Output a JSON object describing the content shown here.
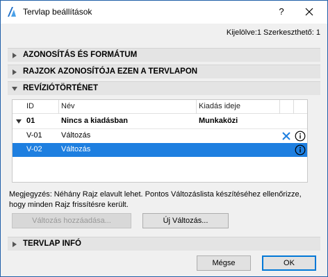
{
  "window": {
    "title": "Tervlap beállítások",
    "help_label": "?",
    "accent": "#1e7fe0"
  },
  "selection_info": "Kijelölve:1 Szerkeszthető: 1",
  "sections": {
    "id_format": "AZONOSÍTÁS ÉS FORMÁTUM",
    "drawings_id": "RAJZOK AZONOSÍTÓJA EZEN A TERVLAPON",
    "revision_history": "REVÍZIÓTÖRTÉNET",
    "sheet_info": "TERVLAP INFÓ"
  },
  "table": {
    "headers": {
      "id": "ID",
      "name": "Név",
      "issue_date": "Kiadás ideje"
    },
    "group": {
      "id": "01",
      "name": "Nincs a kiadásban",
      "issue_date": "Munkaközi"
    },
    "rows": [
      {
        "id": "V-01",
        "name": "Változás",
        "selected": false
      },
      {
        "id": "V-02",
        "name": "Változás",
        "selected": true
      }
    ]
  },
  "note": {
    "line1": "Megjegyzés: Néhány Rajz elavult lehet. Pontos Változáslista készítéséhez ellenőrizze,",
    "line2": "hogy minden Rajz frissítésre került."
  },
  "buttons": {
    "add_change": "Változás hozzáadása...",
    "new_change": "Új Változás...",
    "cancel": "Mégse",
    "ok": "OK"
  }
}
